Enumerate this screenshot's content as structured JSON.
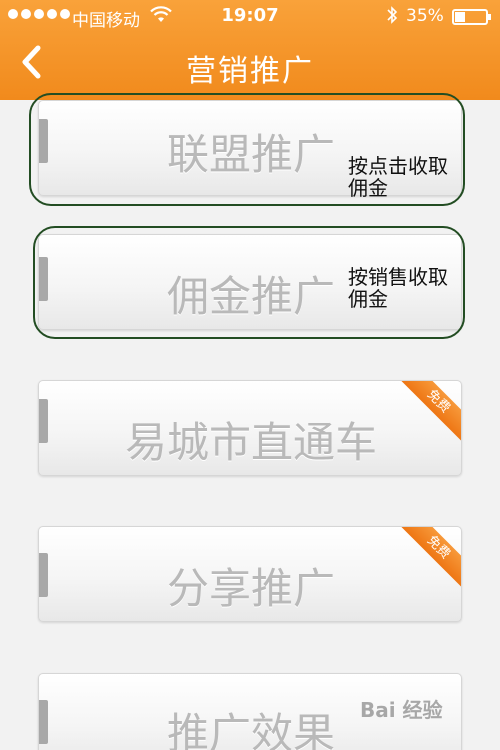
{
  "status_bar": {
    "carrier": "中国移动",
    "time": "19:07",
    "battery": "35%",
    "battery_level": 0.35
  },
  "nav": {
    "title": "营销推广",
    "back_icon": "chevron-left-icon"
  },
  "menu": [
    {
      "label": "联盟推广",
      "note": [
        "按点击收取",
        "佣金"
      ]
    },
    {
      "label": "佣金推广",
      "note": [
        "按销售收取",
        "佣金"
      ]
    },
    {
      "label": "易城市直通车",
      "badge": "免费"
    },
    {
      "label": "分享推广",
      "badge": "免费"
    },
    {
      "label": "推广效果"
    }
  ],
  "watermark": "Bai 经验",
  "colors": {
    "header": "#f18a1c",
    "badge": "#ee7614",
    "outline": "#234d23"
  }
}
